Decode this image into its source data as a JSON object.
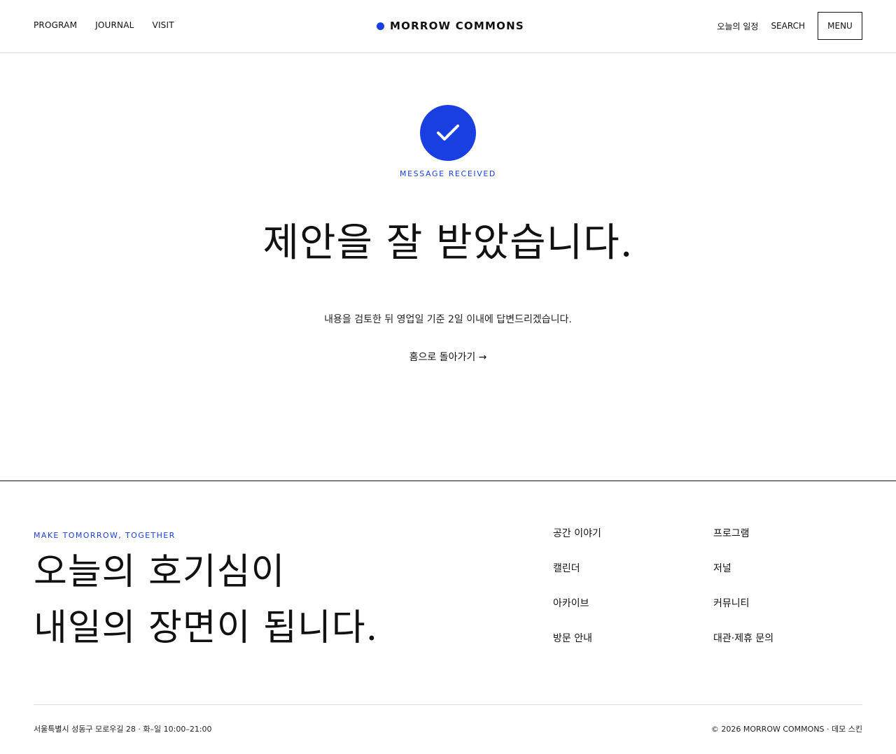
{
  "header": {
    "nav_left": [
      "PROGRAM",
      "JOURNAL",
      "VISIT"
    ],
    "brand": "MORROW COMMONS",
    "today_schedule": "오늘의 일정",
    "search": "SEARCH",
    "menu": "MENU"
  },
  "confirmation": {
    "icon": "check-icon",
    "eyebrow": "MESSAGE RECEIVED",
    "headline": "제안을 잘 받았습니다.",
    "subtext": "내용을 검토한 뒤 영업일 기준 2일 이내에 답변드리겠습니다.",
    "home_link": "홈으로 돌아가기 →"
  },
  "footer": {
    "eyebrow": "MAKE TOMORROW, TOGETHER",
    "heading_lines": [
      "오늘의 호기심이",
      "내일의 장면이 됩니다."
    ],
    "links": [
      "공간 이야기",
      "프로그램",
      "캘린더",
      "저널",
      "아카이브",
      "커뮤니티",
      "방문 안내",
      "대관·제휴 문의"
    ],
    "address": "서울특별시 성동구 모로우길 28 · 화–일 10:00–21:00",
    "copyright": "© 2026 MORROW COMMONS · 데모 스킨"
  },
  "colors": {
    "accent": "#1a3fe0",
    "text": "#111111",
    "rule": "#dcdcdc"
  }
}
